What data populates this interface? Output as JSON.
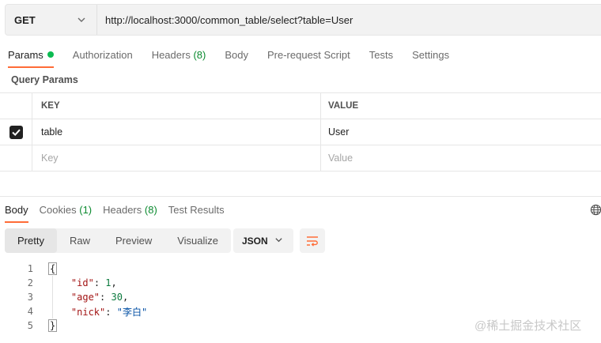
{
  "request": {
    "method": "GET",
    "url": "http://localhost:3000/common_table/select?table=User"
  },
  "request_tabs": [
    {
      "label": "Params",
      "active": true
    },
    {
      "label": "Authorization"
    },
    {
      "label": "Headers",
      "count": "(8)"
    },
    {
      "label": "Body"
    },
    {
      "label": "Pre-request Script"
    },
    {
      "label": "Tests"
    },
    {
      "label": "Settings"
    }
  ],
  "query_params": {
    "title": "Query Params",
    "headers": {
      "key": "KEY",
      "value": "VALUE"
    },
    "rows": [
      {
        "key": "table",
        "value": "User",
        "checked": true
      }
    ],
    "placeholder": {
      "key": "Key",
      "value": "Value"
    }
  },
  "response_tabs": [
    {
      "label": "Body",
      "active": true
    },
    {
      "label": "Cookies",
      "count": "(1)"
    },
    {
      "label": "Headers",
      "count": "(8)"
    },
    {
      "label": "Test Results"
    }
  ],
  "view_modes": [
    "Pretty",
    "Raw",
    "Preview",
    "Visualize"
  ],
  "active_view": "Pretty",
  "format": "JSON",
  "code": {
    "line_numbers": [
      "1",
      "2",
      "3",
      "4",
      "5"
    ],
    "open_brace": "{",
    "close_brace": "}",
    "fields": [
      {
        "key": "\"id\"",
        "value": "1",
        "sep": ","
      },
      {
        "key": "\"age\"",
        "value": "30",
        "sep": ","
      },
      {
        "key": "\"nick\"",
        "value": "\"李白\"",
        "sep": ""
      }
    ]
  },
  "watermark": "@稀土掘金技术社区",
  "colors": {
    "accent": "#ff6c37",
    "dot_green": "#0cbb52",
    "count_green": "#0b8a2f"
  },
  "icons": [
    "chevron-down-icon",
    "checkbox-checked-icon",
    "globe-icon",
    "wrap-lines-icon"
  ]
}
